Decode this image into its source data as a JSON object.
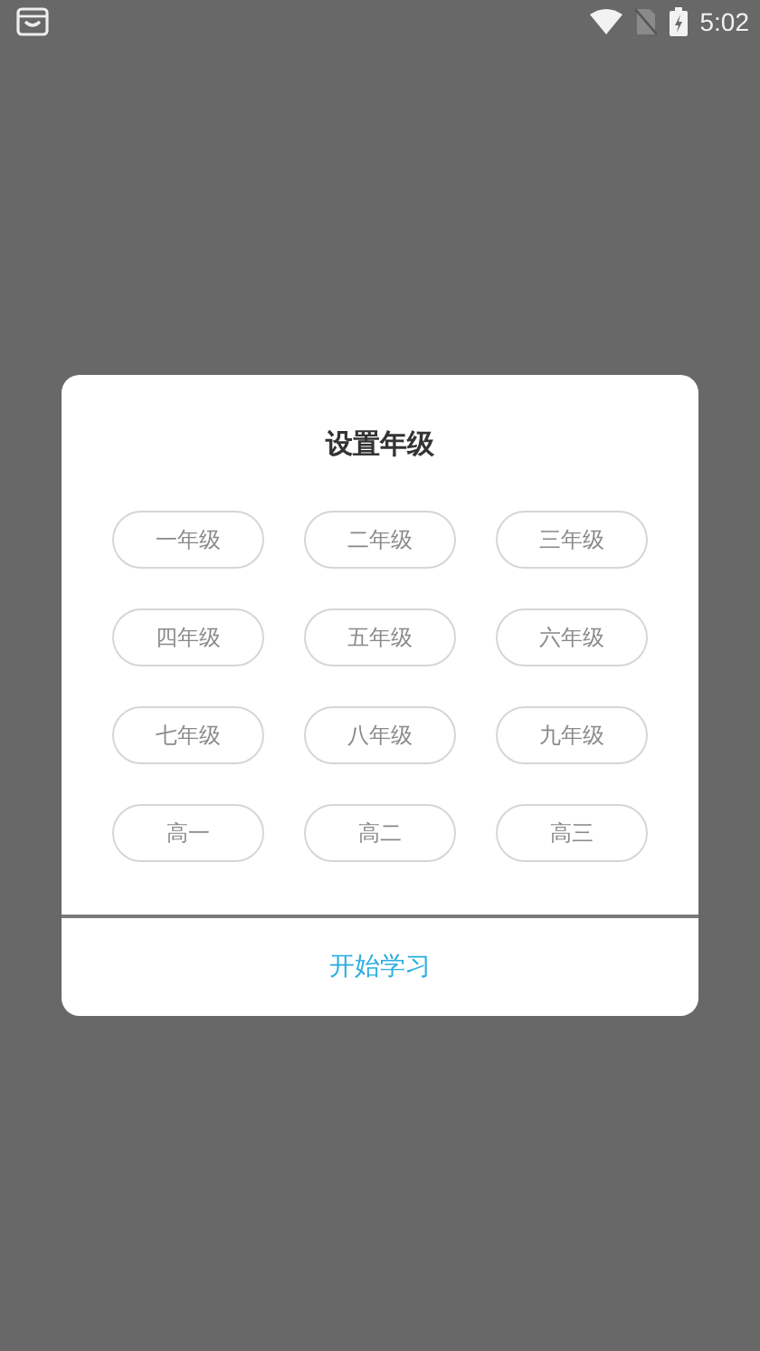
{
  "status_bar": {
    "time": "5:02"
  },
  "dialog": {
    "title": "设置年级",
    "grades": [
      {
        "label": "一年级",
        "selected": false
      },
      {
        "label": "二年级",
        "selected": false
      },
      {
        "label": "三年级",
        "selected": false
      },
      {
        "label": "四年级",
        "selected": false
      },
      {
        "label": "五年级",
        "selected": false
      },
      {
        "label": "六年级",
        "selected": false
      },
      {
        "label": "七年级",
        "selected": false
      },
      {
        "label": "八年级",
        "selected": false
      },
      {
        "label": "九年级",
        "selected": false
      },
      {
        "label": "高一",
        "selected": false
      },
      {
        "label": "高二",
        "selected": false
      },
      {
        "label": "高三",
        "selected": false
      }
    ],
    "confirm": "开始学习"
  }
}
